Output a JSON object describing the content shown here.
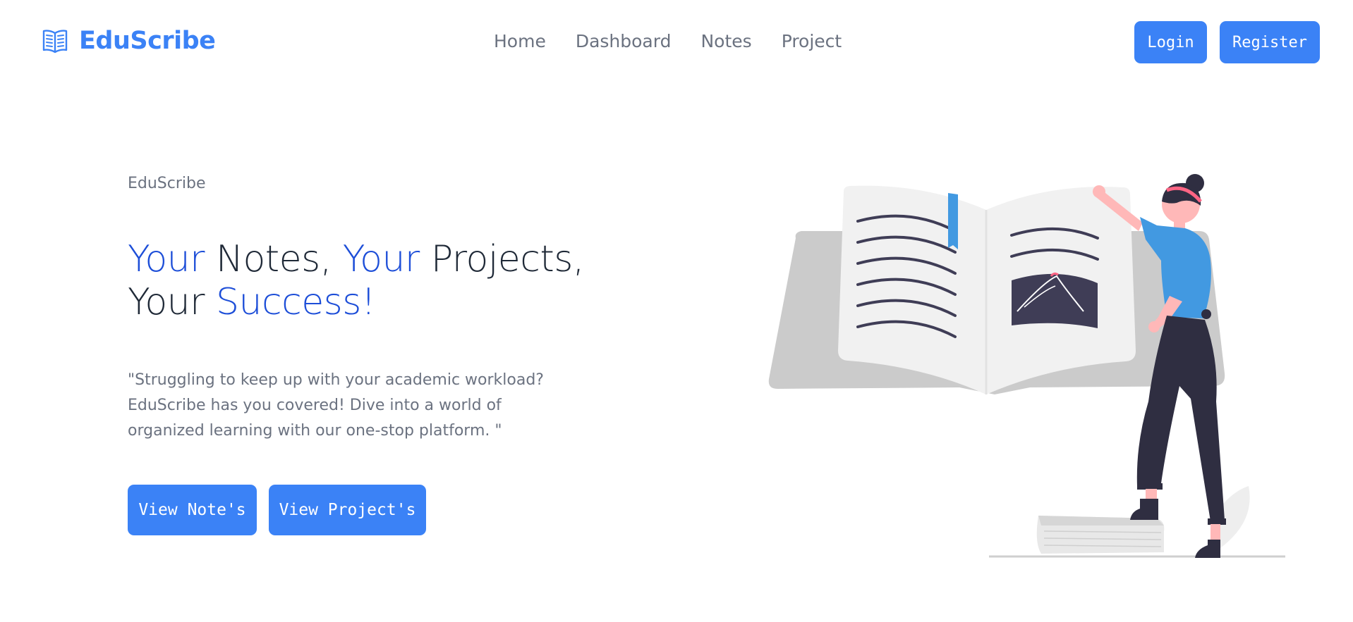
{
  "brand": {
    "name": "EduScribe",
    "icon": "open-book-icon",
    "color": "#3b82f6"
  },
  "nav": {
    "links": [
      {
        "label": "Home"
      },
      {
        "label": "Dashboard"
      },
      {
        "label": "Notes"
      },
      {
        "label": "Project"
      }
    ],
    "login_label": "Login",
    "register_label": "Register"
  },
  "hero": {
    "eyebrow": "EduScribe",
    "headline": {
      "w1": "Your",
      "w2": " Notes, ",
      "w3": "Your",
      "w4": " Projects,",
      "w5": "Your ",
      "w6": "Success!"
    },
    "description": "\"Struggling to keep up with your academic workload? EduScribe has you covered! Dive into a world of organized learning with our one-stop platform. \"",
    "view_notes_label": "View Note's",
    "view_projects_label": "View Project's",
    "illustration": "woman-reading-giant-book-illustration"
  },
  "colors": {
    "primary": "#3b82f6",
    "headline_accent": "#1d4ed8",
    "text_muted": "#6b7280",
    "text_dark": "#1f2937"
  }
}
